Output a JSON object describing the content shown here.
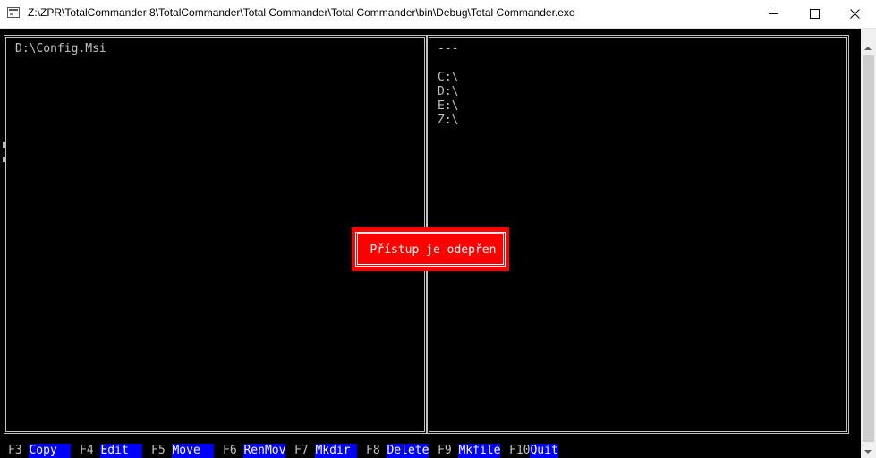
{
  "window": {
    "title": "Z:\\ZPR\\TotalCommander 8\\TotalCommander\\Total Commander\\Total Commander\\bin\\Debug\\Total Commander.exe"
  },
  "left_panel": {
    "path": "D:\\Config.Msi"
  },
  "right_panel": {
    "header": "---",
    "drives": [
      "C:\\",
      "D:\\",
      "E:\\",
      "Z:\\"
    ]
  },
  "error_dialog": {
    "message": "Přístup je odepřen",
    "background_color": "#ff0000"
  },
  "function_keys": [
    {
      "key": "F3",
      "label": "Copy  "
    },
    {
      "key": "F4",
      "label": "Edit  "
    },
    {
      "key": "F5",
      "label": "Move  "
    },
    {
      "key": "F6",
      "label": "RenMov"
    },
    {
      "key": "F7",
      "label": "Mkdir "
    },
    {
      "key": "F8",
      "label": "Delete"
    },
    {
      "key": "F9",
      "label": "Mkfile"
    },
    {
      "key": "F10",
      "label": "Quit"
    }
  ],
  "colors": {
    "console_bg": "#000000",
    "console_fg": "#c0c0c0",
    "key_label_bg": "#0000ff"
  },
  "icons": {
    "app": "console-app-icon",
    "minimize": "minimize-icon",
    "maximize": "maximize-icon",
    "close": "close-icon"
  }
}
